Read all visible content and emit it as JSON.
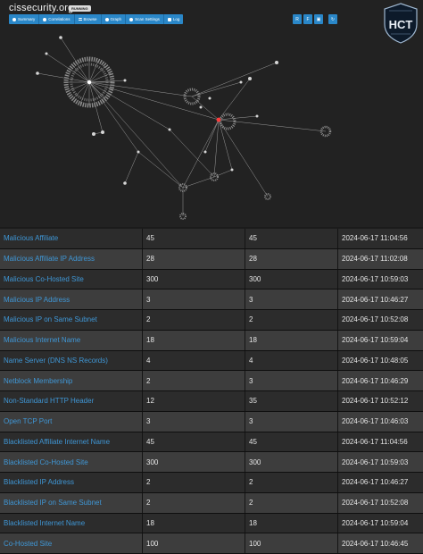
{
  "header": {
    "title": "cissecurity.org",
    "status_badge": "RUNNING",
    "tabs": [
      {
        "label": "Summary",
        "icon": "summary-icon"
      },
      {
        "label": "Correlations",
        "icon": "info-icon"
      },
      {
        "label": "Browse",
        "icon": "list-icon"
      },
      {
        "label": "Graph",
        "icon": "graph-icon"
      },
      {
        "label": "Scan Settings",
        "icon": "settings-icon"
      },
      {
        "label": "Log",
        "icon": "log-icon"
      }
    ],
    "right_buttons": [
      {
        "label": "R",
        "icon": "r-icon"
      },
      {
        "label": "F",
        "icon": "f-icon"
      },
      {
        "label": "▣",
        "icon": "image-icon"
      },
      {
        "label": "↻",
        "icon": "refresh-icon"
      }
    ],
    "logo_text": "HCT"
  },
  "colors": {
    "accent": "#2a87c8",
    "link": "#3f97d6",
    "graph_highlight": "#ff3b3b"
  },
  "table": {
    "rows": [
      {
        "type": "Malicious Affiliate",
        "unique": "45",
        "total": "45",
        "last": "2024-06-17 11:04:56"
      },
      {
        "type": "Malicious Affiliate IP Address",
        "unique": "28",
        "total": "28",
        "last": "2024-06-17 11:02:08"
      },
      {
        "type": "Malicious Co-Hosted Site",
        "unique": "300",
        "total": "300",
        "last": "2024-06-17 10:59:03"
      },
      {
        "type": "Malicious IP Address",
        "unique": "3",
        "total": "3",
        "last": "2024-06-17 10:46:27"
      },
      {
        "type": "Malicious IP on Same Subnet",
        "unique": "2",
        "total": "2",
        "last": "2024-06-17 10:52:08"
      },
      {
        "type": "Malicious Internet Name",
        "unique": "18",
        "total": "18",
        "last": "2024-06-17 10:59:04"
      },
      {
        "type": "Name Server (DNS NS Records)",
        "unique": "4",
        "total": "4",
        "last": "2024-06-17 10:48:05"
      },
      {
        "type": "Netblock Membership",
        "unique": "2",
        "total": "3",
        "last": "2024-06-17 10:46:29"
      },
      {
        "type": "Non-Standard HTTP Header",
        "unique": "12",
        "total": "35",
        "last": "2024-06-17 10:52:12"
      },
      {
        "type": "Open TCP Port",
        "unique": "3",
        "total": "3",
        "last": "2024-06-17 10:46:03"
      },
      {
        "type": "Blacklisted Affiliate Internet Name",
        "unique": "45",
        "total": "45",
        "last": "2024-06-17 11:04:56"
      },
      {
        "type": "Blacklisted Co-Hosted Site",
        "unique": "300",
        "total": "300",
        "last": "2024-06-17 10:59:03"
      },
      {
        "type": "Blacklisted IP Address",
        "unique": "2",
        "total": "2",
        "last": "2024-06-17 10:46:27"
      },
      {
        "type": "Blacklisted IP on Same Subnet",
        "unique": "2",
        "total": "2",
        "last": "2024-06-17 10:52:08"
      },
      {
        "type": "Blacklisted Internet Name",
        "unique": "18",
        "total": "18",
        "last": "2024-06-17 10:59:04"
      },
      {
        "type": "Co-Hosted Site",
        "unique": "100",
        "total": "100",
        "last": "2024-06-17 10:46:45"
      }
    ]
  }
}
